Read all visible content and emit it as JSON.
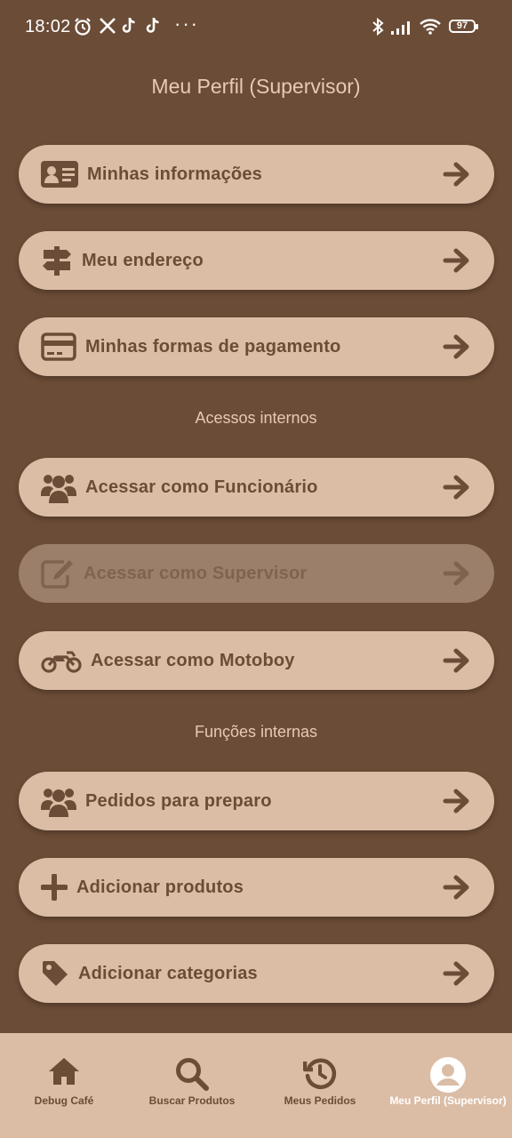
{
  "status_bar": {
    "time": "18:02",
    "battery": "97",
    "more": "···"
  },
  "page_title": "Meu Perfil (Supervisor)",
  "profile_items": [
    {
      "label": "Minhas informações",
      "icon": "id-card-icon"
    },
    {
      "label": "Meu endereço",
      "icon": "signpost-icon"
    },
    {
      "label": "Minhas formas de pagamento",
      "icon": "credit-card-icon"
    }
  ],
  "section_access": "Acessos internos",
  "access_items": [
    {
      "label": "Acessar como Funcionário",
      "icon": "users-icon"
    },
    {
      "label": "Acessar como Supervisor",
      "icon": "edit-icon",
      "disabled": true
    },
    {
      "label": "Acessar como Motoboy",
      "icon": "motorcycle-icon"
    }
  ],
  "section_functions": "Funções internas",
  "function_items": [
    {
      "label": "Pedidos para preparo",
      "icon": "users-icon"
    },
    {
      "label": "Adicionar produtos",
      "icon": "plus-icon"
    },
    {
      "label": "Adicionar categorias",
      "icon": "tag-icon"
    }
  ],
  "bottom_nav": [
    {
      "label": "Debug Café",
      "icon": "home-icon"
    },
    {
      "label": "Buscar Produtos",
      "icon": "search-icon"
    },
    {
      "label": "Meus Pedidos",
      "icon": "history-icon"
    },
    {
      "label": "Meu Perfil (Supervisor)",
      "icon": "account-circle-icon",
      "active": true
    }
  ],
  "colors": {
    "background": "#6b4c36",
    "card": "#dbbda6",
    "card_disabled": "#9c7f6a",
    "text_primary": "#6b4c36",
    "text_light": "#e6cab5"
  }
}
